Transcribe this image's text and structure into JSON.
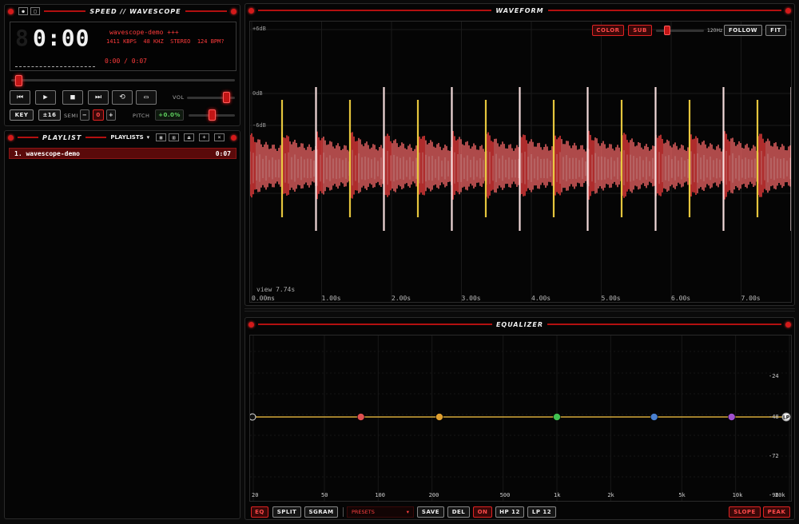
{
  "player": {
    "title": "SPEED // WAVESCOPE",
    "time_display": "0:00",
    "track_title": "wavescope-demo +++",
    "info": {
      "bitrate": "1411 KBPS",
      "rate": "48 KHZ",
      "mode": "STEREO",
      "bpm": "124 BPM?"
    },
    "position": "0:00 / 0:07",
    "progress_fraction": 0.02,
    "vol_label": "VOL",
    "volume_fraction": 0.88,
    "key_label": "KEY",
    "range_label": "±16",
    "semi_label": "SEMI",
    "semi_value": "0",
    "pitch_label": "PITCH",
    "pitch_value": "+0.0%",
    "pitch_fraction": 0.5
  },
  "playlist": {
    "title": "PLAYLIST",
    "dropdown_label": "PLAYLISTS",
    "items": [
      {
        "index": "1.",
        "name": "wavescope-demo",
        "duration": "0:07"
      }
    ]
  },
  "waveform": {
    "title": "WAVEFORM",
    "color_button": "COLOR",
    "sub_button": "SUB",
    "freq_label": "120Hz",
    "follow_button": "FOLLOW",
    "fit_button": "FIT",
    "db_labels": [
      "+6dB",
      "0dB",
      "-6dB"
    ],
    "view_label": "view 7.74s",
    "time_ticks": [
      "0.00ms",
      "1.00s",
      "2.00s",
      "3.00s",
      "4.00s",
      "5.00s",
      "6.00s",
      "7.00s"
    ]
  },
  "equalizer": {
    "title": "EQUALIZER",
    "freq_ticks": [
      "20",
      "50",
      "100",
      "200",
      "500",
      "1k",
      "2k",
      "5k",
      "10k",
      "20k"
    ],
    "db_ticks": [
      "-24",
      "-48",
      "-72",
      "-96"
    ],
    "bands": [
      {
        "freq": 80,
        "color": "#e05050"
      },
      {
        "freq": 220,
        "color": "#e0a030"
      },
      {
        "freq": 1000,
        "color": "#40c050"
      },
      {
        "freq": 3500,
        "color": "#4a80d0"
      },
      {
        "freq": 9500,
        "color": "#a050d0"
      }
    ],
    "left_handle": "",
    "right_handle": "LP",
    "toolbar": {
      "eq": "EQ",
      "split": "SPLIT",
      "sgram": "SGRAM",
      "presets": "PRESETS",
      "save": "SAVE",
      "del": "DEL",
      "on": "ON",
      "hp": "HP 12",
      "lp": "LP 12",
      "slope": "SLOPE",
      "peak": "PEAK"
    }
  },
  "colors": {
    "accent": "#e02323",
    "wave": "#ff5a5a",
    "transient": "#f0d040"
  }
}
